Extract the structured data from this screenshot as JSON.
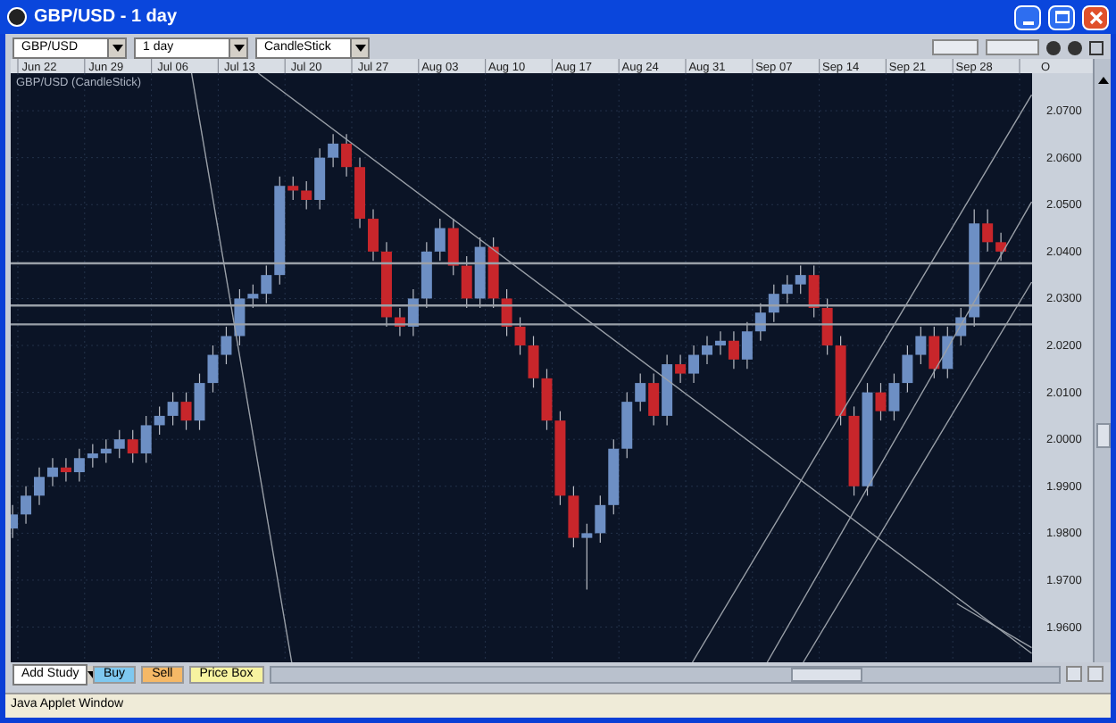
{
  "window": {
    "title": "GBP/USD - 1 day"
  },
  "toolbar": {
    "selects": [
      {
        "value": "GBP/USD"
      },
      {
        "value": "1 day"
      },
      {
        "value": "CandleStick"
      }
    ]
  },
  "chart": {
    "chart_data": {
      "type": "candlestick",
      "title": "GBP/USD (CandleStick)",
      "grid": true,
      "ylim": [
        1.9525,
        2.078
      ],
      "categories": [
        null,
        null,
        "Jun 22",
        null,
        null,
        null,
        null,
        "Jun 29",
        null,
        null,
        null,
        null,
        "Jul 06",
        null,
        null,
        null,
        null,
        "Jul 13",
        null,
        null,
        null,
        null,
        "Jul 20",
        null,
        null,
        null,
        null,
        "Jul 27",
        null,
        null,
        null,
        null,
        "Aug 03",
        null,
        null,
        null,
        null,
        "Aug 10",
        null,
        null,
        null,
        null,
        "Aug 17",
        null,
        null,
        null,
        null,
        "Aug 24",
        null,
        null,
        null,
        null,
        "Aug 31",
        null,
        null,
        null,
        null,
        "Sep 07",
        null,
        null,
        null,
        null,
        "Sep 14",
        null,
        null,
        null,
        null,
        "Sep 21",
        null,
        null,
        null,
        null,
        "Sep 28",
        null,
        null,
        null,
        null,
        "O"
      ],
      "yticks": [
        {
          "value": 2.07,
          "label": "2.0700"
        },
        {
          "value": 2.06,
          "label": "2.0600"
        },
        {
          "value": 2.05,
          "label": "2.0500"
        },
        {
          "value": 2.04,
          "label": "2.0400"
        },
        {
          "value": 2.03,
          "label": "2.0300"
        },
        {
          "value": 2.02,
          "label": "2.0200"
        },
        {
          "value": 2.01,
          "label": "2.0100"
        },
        {
          "value": 2.0,
          "label": "2.0000"
        },
        {
          "value": 1.99,
          "label": "1.9900"
        },
        {
          "value": 1.98,
          "label": "1.9800"
        },
        {
          "value": 1.97,
          "label": "1.9700"
        },
        {
          "value": 1.96,
          "label": "1.9600"
        }
      ],
      "ohlc": [
        [
          1.981,
          1.986,
          1.979,
          1.984
        ],
        [
          1.984,
          1.99,
          1.982,
          1.988
        ],
        [
          1.988,
          1.994,
          1.986,
          1.992
        ],
        [
          1.992,
          1.996,
          1.99,
          1.994
        ],
        [
          1.994,
          1.996,
          1.991,
          1.993
        ],
        [
          1.993,
          1.998,
          1.991,
          1.996
        ],
        [
          1.996,
          1.999,
          1.994,
          1.997
        ],
        [
          1.997,
          2.0,
          1.995,
          1.998
        ],
        [
          1.998,
          2.002,
          1.996,
          2.0
        ],
        [
          2.0,
          2.002,
          1.995,
          1.997
        ],
        [
          1.997,
          2.005,
          1.995,
          2.003
        ],
        [
          2.003,
          2.007,
          2.001,
          2.005
        ],
        [
          2.005,
          2.01,
          2.003,
          2.008
        ],
        [
          2.008,
          2.01,
          2.002,
          2.004
        ],
        [
          2.004,
          2.014,
          2.002,
          2.012
        ],
        [
          2.012,
          2.02,
          2.01,
          2.018
        ],
        [
          2.018,
          2.024,
          2.016,
          2.022
        ],
        [
          2.022,
          2.032,
          2.02,
          2.03
        ],
        [
          2.03,
          2.033,
          2.028,
          2.031
        ],
        [
          2.031,
          2.037,
          2.029,
          2.035
        ],
        [
          2.035,
          2.056,
          2.033,
          2.054
        ],
        [
          2.054,
          2.056,
          2.051,
          2.053
        ],
        [
          2.053,
          2.055,
          2.049,
          2.051
        ],
        [
          2.051,
          2.062,
          2.049,
          2.06
        ],
        [
          2.06,
          2.065,
          2.058,
          2.063
        ],
        [
          2.063,
          2.065,
          2.056,
          2.058
        ],
        [
          2.058,
          2.06,
          2.045,
          2.047
        ],
        [
          2.047,
          2.049,
          2.038,
          2.04
        ],
        [
          2.04,
          2.042,
          2.024,
          2.026
        ],
        [
          2.026,
          2.028,
          2.022,
          2.024
        ],
        [
          2.024,
          2.032,
          2.022,
          2.03
        ],
        [
          2.03,
          2.042,
          2.028,
          2.04
        ],
        [
          2.04,
          2.047,
          2.038,
          2.045
        ],
        [
          2.045,
          2.047,
          2.035,
          2.037
        ],
        [
          2.037,
          2.039,
          2.028,
          2.03
        ],
        [
          2.03,
          2.043,
          2.028,
          2.041
        ],
        [
          2.041,
          2.043,
          2.028,
          2.03
        ],
        [
          2.03,
          2.032,
          2.022,
          2.024
        ],
        [
          2.024,
          2.026,
          2.018,
          2.02
        ],
        [
          2.02,
          2.022,
          2.011,
          2.013
        ],
        [
          2.013,
          2.015,
          2.002,
          2.004
        ],
        [
          2.004,
          2.006,
          1.986,
          1.988
        ],
        [
          1.988,
          1.99,
          1.977,
          1.979
        ],
        [
          1.979,
          1.982,
          1.968,
          1.98
        ],
        [
          1.98,
          1.988,
          1.978,
          1.986
        ],
        [
          1.986,
          2.0,
          1.984,
          1.998
        ],
        [
          1.998,
          2.01,
          1.996,
          2.008
        ],
        [
          2.008,
          2.014,
          2.006,
          2.012
        ],
        [
          2.012,
          2.014,
          2.003,
          2.005
        ],
        [
          2.005,
          2.018,
          2.003,
          2.016
        ],
        [
          2.016,
          2.018,
          2.012,
          2.014
        ],
        [
          2.014,
          2.02,
          2.012,
          2.018
        ],
        [
          2.018,
          2.022,
          2.016,
          2.02
        ],
        [
          2.02,
          2.023,
          2.018,
          2.021
        ],
        [
          2.021,
          2.023,
          2.015,
          2.017
        ],
        [
          2.017,
          2.025,
          2.015,
          2.023
        ],
        [
          2.023,
          2.029,
          2.021,
          2.027
        ],
        [
          2.027,
          2.033,
          2.025,
          2.031
        ],
        [
          2.031,
          2.035,
          2.029,
          2.033
        ],
        [
          2.033,
          2.037,
          2.031,
          2.035
        ],
        [
          2.035,
          2.037,
          2.026,
          2.028
        ],
        [
          2.028,
          2.03,
          2.018,
          2.02
        ],
        [
          2.02,
          2.022,
          2.003,
          2.005
        ],
        [
          2.005,
          2.007,
          1.988,
          1.99
        ],
        [
          1.99,
          2.012,
          1.988,
          2.01
        ],
        [
          2.01,
          2.012,
          2.004,
          2.006
        ],
        [
          2.006,
          2.014,
          2.004,
          2.012
        ],
        [
          2.012,
          2.02,
          2.01,
          2.018
        ],
        [
          2.018,
          2.024,
          2.016,
          2.022
        ],
        [
          2.022,
          2.024,
          2.013,
          2.015
        ],
        [
          2.015,
          2.024,
          2.013,
          2.022
        ],
        [
          2.022,
          2.028,
          2.02,
          2.026
        ],
        [
          2.026,
          2.049,
          2.024,
          2.046
        ],
        [
          2.046,
          2.049,
          2.04,
          2.042
        ],
        [
          2.042,
          2.044,
          2.038,
          2.04
        ],
        null,
        null,
        null
      ]
    }
  },
  "bottom_bar": {
    "study_select": "Add Study",
    "buttons": [
      {
        "label": "Buy",
        "color": "#7ec8f0"
      },
      {
        "label": "Sell",
        "color": "#f5b866"
      },
      {
        "label": "Price Box",
        "color": "#f7f3a0"
      }
    ]
  },
  "status_bar": {
    "text": "Java Applet Window"
  }
}
